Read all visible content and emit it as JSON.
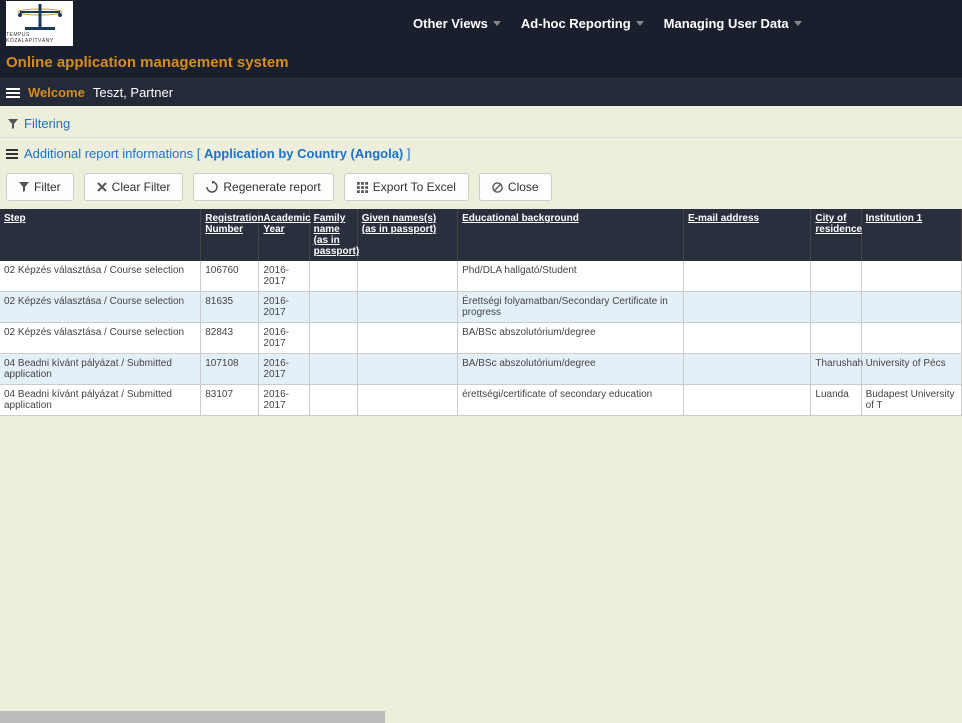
{
  "brand": {
    "logo_text": "TEMPUS KÖZALAPÍTVÁNY"
  },
  "nav": {
    "items": [
      {
        "label": "Other Views"
      },
      {
        "label": "Ad-hoc Reporting"
      },
      {
        "label": "Managing User Data"
      }
    ]
  },
  "title": "Online application management system",
  "welcome": {
    "label": "Welcome",
    "user": "Teszt, Partner"
  },
  "filtering": {
    "label": "Filtering"
  },
  "info": {
    "prefix": "Additional report informations",
    "open": " [ ",
    "report": "Application by Country (Angola)",
    "close": " ]"
  },
  "buttons": {
    "filter": "Filter",
    "clear": "Clear Filter",
    "regen": "Regenerate report",
    "export": "Export To Excel",
    "close": "Close"
  },
  "table": {
    "headers": {
      "step": "Step",
      "reg": "Registration Number",
      "year": "Academic Year",
      "family": "Family name (as in passport)",
      "given": "Given names(s) (as in passport)",
      "edu": "Educational background",
      "email": "E-mail address",
      "city": "City of residence",
      "inst": "Institution 1"
    },
    "rows": [
      {
        "step": "02 Képzés választása / Course selection",
        "reg": "106760",
        "year": "2016-2017",
        "family": "",
        "given": "",
        "edu": "Phd/DLA hallgató/Student",
        "email": "",
        "city": "",
        "inst": "",
        "alt": false,
        "tall": false
      },
      {
        "step": "02 Képzés választása / Course selection",
        "reg": "81635",
        "year": "2016-2017",
        "family": "",
        "given": "",
        "edu": "Érettségi folyamatban/Secondary Certificate in progress",
        "email": "",
        "city": "",
        "inst": "",
        "alt": true,
        "tall": false
      },
      {
        "step": "02 Képzés választása / Course selection",
        "reg": "82843",
        "year": "2016-2017",
        "family": "",
        "given": "",
        "edu": "BA/BSc abszolutórium/degree",
        "email": "",
        "city": "",
        "inst": "",
        "alt": false,
        "tall": false
      },
      {
        "step": "04 Beadni kívánt pályázat / Submitted application",
        "reg": "107108",
        "year": "2016-2017",
        "family": "",
        "given": "",
        "edu": "BA/BSc abszolutórium/degree",
        "email": "",
        "city": "Tharushah",
        "inst": "University of Pécs",
        "alt": true,
        "tall": true
      },
      {
        "step": "04 Beadni kívánt pályázat / Submitted application",
        "reg": "83107",
        "year": "2016-2017",
        "family": "",
        "given": "",
        "edu": "érettségi/certificate of secondary education",
        "email": "",
        "city": "Luanda",
        "inst": "Budapest University of T",
        "alt": false,
        "tall": true
      }
    ]
  }
}
